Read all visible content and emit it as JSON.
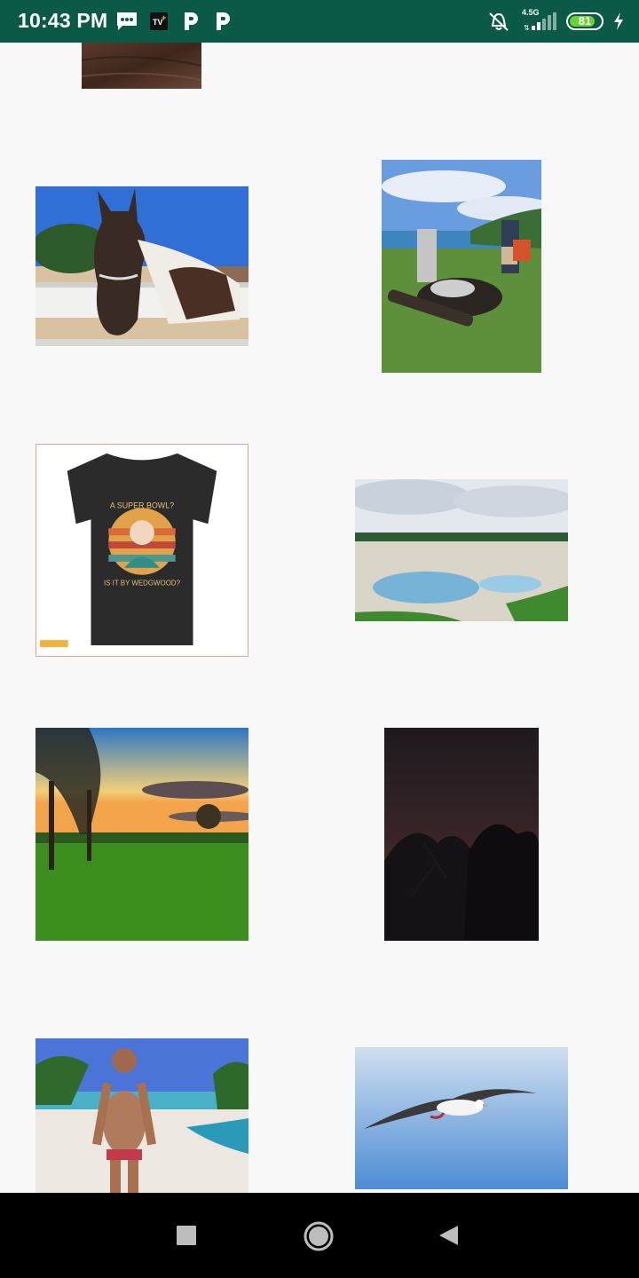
{
  "status_bar": {
    "time": "10:43 PM",
    "network_type": "4.5G",
    "battery_level": "81",
    "battery_fraction": 0.81,
    "icons": [
      "message-icon",
      "tv-plus-icon",
      "p-app-icon",
      "p-app-icon",
      "alarm-off-icon",
      "signal-icon",
      "battery-icon",
      "charging-icon"
    ]
  },
  "gallery": {
    "images": [
      {
        "name": "wood-photo",
        "subject": "wooden surface (partially visible)"
      },
      {
        "name": "horse-photo",
        "subject": "horse behind a white fence"
      },
      {
        "name": "campfire-photo",
        "subject": "two men near a log fire pit by a lake"
      },
      {
        "name": "tshirt-photo",
        "subject": "black t-shirt with retro sunset print",
        "caption_top": "A SUPER BOWL?",
        "caption_bottom": "IS IT BY WEDGWOOD?"
      },
      {
        "name": "hot-spring-photo",
        "subject": "geothermal hot spring landscape"
      },
      {
        "name": "sunset-park-photo",
        "subject": "sunset over a green park with trees"
      },
      {
        "name": "night-trees-photo",
        "subject": "silhouetted trees at night"
      },
      {
        "name": "beach-avatar-photo",
        "subject": "3D avatar on a tropical beach"
      },
      {
        "name": "seagull-photo",
        "subject": "seagull flying in blue sky"
      }
    ]
  },
  "nav_bar": {
    "buttons": [
      "recents-button",
      "home-button",
      "back-button"
    ]
  },
  "colors": {
    "status_bar_bg": "#0a5a47",
    "page_bg": "#f8f8f8",
    "battery_green": "#6ad12f",
    "nav_bar_bg": "#000000"
  }
}
